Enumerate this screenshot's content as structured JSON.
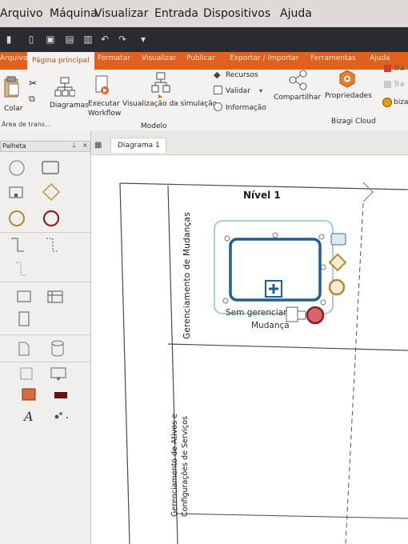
{
  "vm_menu": [
    "Arquivo",
    "Máquina",
    "Visualizar",
    "Entrada",
    "Dispositivos",
    "Ajuda"
  ],
  "ribbon_tabs": [
    "Arquivo",
    "Página principal",
    "Formatar",
    "Visualizar",
    "Publicar",
    "Exportar / Importar",
    "Ferramentas",
    "Ajuda"
  ],
  "ribbon": {
    "paste": "Colar",
    "clipboard_group": "Área de trans...",
    "diagrams": "Diagramas",
    "run_workflow_1": "Executar",
    "run_workflow_2": "Workflow",
    "simulation": "Visualização da simulação",
    "resources": "Recursos",
    "validate": "Validar",
    "information": "Informação",
    "model_group": "Modelo",
    "share": "Compartilhar",
    "properties": "Propriedades",
    "cloud_group": "Bizagi Cloud",
    "right_1": "Tra",
    "right_2": "Tra",
    "right_3": "biza"
  },
  "palette": {
    "title": "Palheta"
  },
  "doc_tab": "Diagrama 1",
  "diagram": {
    "pool_title": "Nível 1",
    "lane_1": "Gerenciamento de Mudanças",
    "lane_2_line1": "Gerenciamento de Ativos e",
    "lane_2_line2": "Configurações de Serviços",
    "task_label_1": "Sem gerenciar",
    "task_label_2": "Mudança"
  },
  "colors": {
    "ribbon_orange": "#e0601c",
    "task_blue": "#1f5f96",
    "selection_teal": "#9cc6c6"
  }
}
